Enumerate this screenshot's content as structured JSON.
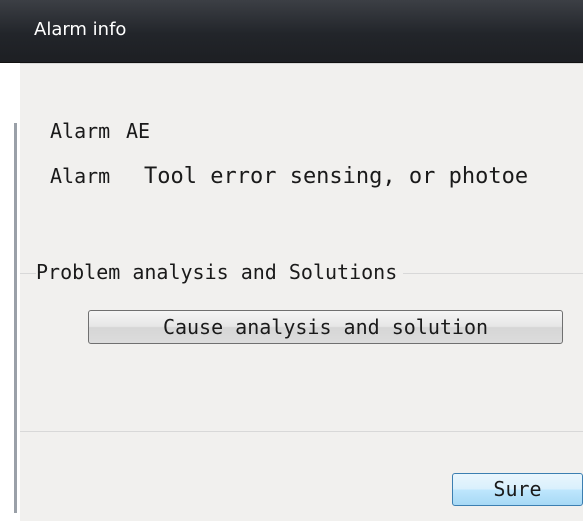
{
  "window": {
    "title": "Alarm info"
  },
  "alarm": {
    "code_label": "Alarm",
    "code_value": "AE",
    "desc_label": "Alarm",
    "desc_value": "Tool error sensing, or photoe"
  },
  "analysis_group": {
    "legend": "Problem analysis and Solutions",
    "cause_button_label": "Cause analysis and solution"
  },
  "footer": {
    "sure_label": "Sure"
  }
}
